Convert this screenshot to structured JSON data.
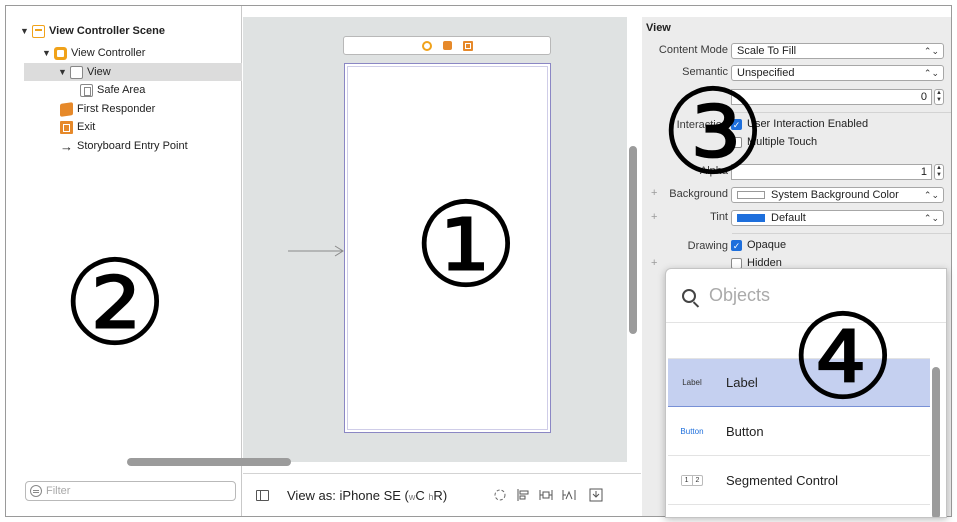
{
  "outline": {
    "items": [
      {
        "label": "View Controller Scene"
      },
      {
        "label": "View Controller"
      },
      {
        "label": "View"
      },
      {
        "label": "Safe Area"
      },
      {
        "label": "First Responder"
      },
      {
        "label": "Exit"
      },
      {
        "label": "Storyboard Entry Point"
      }
    ],
    "filter_placeholder": "Filter"
  },
  "canvas": {
    "view_as_prefix": "View as: iPhone SE (",
    "size_w_small": "w",
    "size_w_big": "C",
    "size_h_small": "h",
    "size_h_big": "R",
    "view_as_suffix": ")"
  },
  "inspector": {
    "section_title": "View",
    "content_mode_label": "Content Mode",
    "content_mode_value": "Scale To Fill",
    "semantic_label": "Semantic",
    "semantic_value": "Unspecified",
    "tag_value": "0",
    "interaction_label": "Interaction",
    "user_interaction_label": "User Interaction Enabled",
    "multiple_touch_label": "Multiple Touch",
    "alpha_label": "Alpha",
    "alpha_value": "1",
    "background_label": "Background",
    "background_value": "System Background Color",
    "tint_label": "Tint",
    "tint_value": "Default",
    "tint_color": "#1e6fdc",
    "drawing_label": "Drawing",
    "opaque_label": "Opaque",
    "hidden_label": "Hidden"
  },
  "library": {
    "search_placeholder": "Objects",
    "items": [
      {
        "icon": "Label",
        "name": "Label"
      },
      {
        "icon": "Button",
        "name": "Button"
      },
      {
        "icon_a": "1",
        "icon_b": "2",
        "name": "Segmented Control"
      }
    ]
  },
  "callouts": [
    "①",
    "②",
    "③",
    "④"
  ],
  "colors": {
    "accent": "#1e6fdc",
    "selection": "#c5d0f0",
    "scene_icon": "#f0a21a"
  }
}
